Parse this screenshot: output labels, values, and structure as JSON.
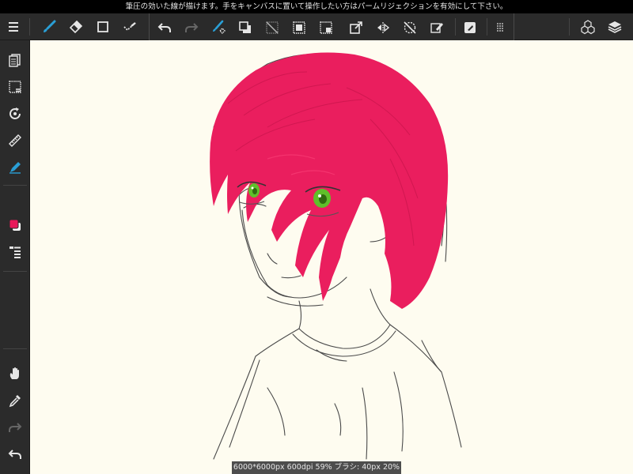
{
  "banner": {
    "message": "筆圧の効いた線が描けます。手をキャンバスに置いて操作したい方はパームリジェクションを有効にして下さい。"
  },
  "toolbar": {
    "left_tools": [
      {
        "name": "menu-icon"
      },
      {
        "name": "brush-icon"
      },
      {
        "name": "eraser-icon"
      },
      {
        "name": "rectangle-icon"
      },
      {
        "name": "magic-wand-icon"
      }
    ],
    "command_tools": [
      {
        "name": "undo-icon"
      },
      {
        "name": "redo-icon"
      },
      {
        "name": "fill-icon"
      },
      {
        "name": "color-swap-icon"
      },
      {
        "name": "clear-icon"
      },
      {
        "name": "select-all-icon"
      },
      {
        "name": "selection-fill-icon"
      },
      {
        "name": "transform-icon"
      },
      {
        "name": "flip-icon"
      },
      {
        "name": "deselect-icon"
      },
      {
        "name": "edit-selection-icon"
      },
      {
        "name": "filter-icon"
      },
      {
        "name": "more-icon"
      }
    ],
    "right_tools": [
      {
        "name": "materials-icon"
      },
      {
        "name": "layers-icon"
      }
    ]
  },
  "sidebar": {
    "tools": [
      {
        "name": "pages-icon"
      },
      {
        "name": "selection-icon"
      },
      {
        "name": "rotate-icon"
      },
      {
        "name": "ruler-icon"
      },
      {
        "name": "pen-icon"
      },
      {
        "name": "color-swatch"
      },
      {
        "name": "brush-list-icon"
      },
      {
        "name": "hand-icon"
      },
      {
        "name": "eyedropper-icon"
      },
      {
        "name": "redo-icon"
      },
      {
        "name": "undo-icon"
      }
    ],
    "colors": {
      "foreground": "#e8195a",
      "background": "#ffffff"
    }
  },
  "colors": {
    "accent": "#2a9fd6",
    "hair": "#ea1e5e",
    "eye": "#5fbf2a",
    "canvas_bg": "#fefcf0"
  },
  "status": {
    "text": "6000*6000px 600dpi 59% ブラシ: 40px 20%"
  }
}
